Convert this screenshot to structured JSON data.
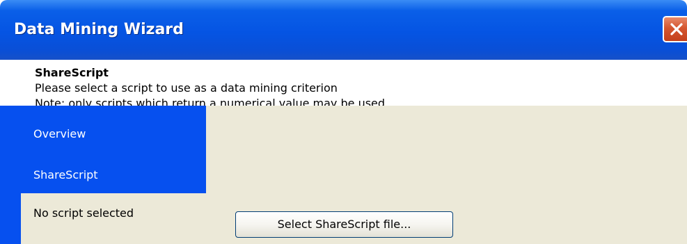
{
  "window": {
    "title": "Data Mining Wizard",
    "close_icon": "close-icon"
  },
  "header": {
    "title": "ShareScript",
    "line1": "Please select a script to use as a data mining criterion",
    "line2": "Note: only scripts which return a numerical value may be used"
  },
  "sidebar": {
    "items": [
      {
        "label": "Overview"
      },
      {
        "label": "ShareScript"
      }
    ],
    "status": "No script selected"
  },
  "main": {
    "select_button_label": "Select ShareScript file..."
  },
  "colors": {
    "titlebar": "#0554e3",
    "sidebar": "#0650ef",
    "body_bg": "#ece9d8",
    "close_button": "#d4562f"
  }
}
